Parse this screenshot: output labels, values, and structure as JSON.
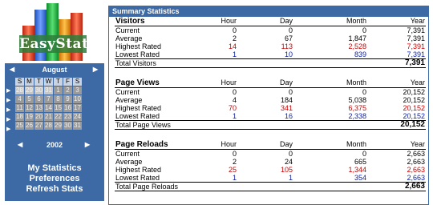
{
  "logo": {
    "text": "EasyStat"
  },
  "calendar": {
    "month": "August",
    "year": "2002",
    "weekdays": [
      "S",
      "M",
      "T",
      "W",
      "T",
      "F",
      "S"
    ],
    "weeks": [
      [
        28,
        29,
        30,
        31,
        1,
        2,
        3
      ],
      [
        4,
        5,
        6,
        7,
        8,
        9,
        10
      ],
      [
        11,
        12,
        13,
        14,
        15,
        16,
        17
      ],
      [
        18,
        19,
        20,
        21,
        22,
        23,
        24
      ],
      [
        25,
        26,
        27,
        28,
        29,
        30,
        31
      ]
    ],
    "prev_month_days": [
      28,
      29,
      30,
      31
    ]
  },
  "nav": {
    "links": [
      "My Statistics",
      "Preferences",
      "Refresh Stats"
    ]
  },
  "summary": {
    "title": "Summary Statistics",
    "columns": [
      "Hour",
      "Day",
      "Month",
      "Year"
    ],
    "sections": [
      {
        "name": "Visitors",
        "rows": [
          {
            "label": "Current",
            "values": [
              "0",
              "0",
              "0",
              "7,391"
            ]
          },
          {
            "label": "Average",
            "values": [
              "2",
              "67",
              "1,847",
              "7,391"
            ]
          },
          {
            "label": "Highest Rated",
            "values": [
              "14",
              "113",
              "2,528",
              "7,391"
            ]
          },
          {
            "label": "Lowest Rated",
            "values": [
              "1",
              "10",
              "839",
              "7,391"
            ]
          }
        ],
        "total_label": "Total Visitors",
        "total_value": "7,391"
      },
      {
        "name": "Page Views",
        "rows": [
          {
            "label": "Current",
            "values": [
              "0",
              "0",
              "0",
              "20,152"
            ]
          },
          {
            "label": "Average",
            "values": [
              "4",
              "184",
              "5,038",
              "20,152"
            ]
          },
          {
            "label": "Highest Rated",
            "values": [
              "70",
              "341",
              "6,375",
              "20,152"
            ]
          },
          {
            "label": "Lowest Rated",
            "values": [
              "1",
              "16",
              "2,338",
              "20,152"
            ]
          }
        ],
        "total_label": "Total Page Views",
        "total_value": "20,152"
      },
      {
        "name": "Page Reloads",
        "rows": [
          {
            "label": "Current",
            "values": [
              "0",
              "0",
              "0",
              "2,663"
            ]
          },
          {
            "label": "Average",
            "values": [
              "2",
              "24",
              "665",
              "2,663"
            ]
          },
          {
            "label": "Highest Rated",
            "values": [
              "25",
              "105",
              "1,344",
              "2,663"
            ]
          },
          {
            "label": "Lowest Rated",
            "values": [
              "1",
              "1",
              "354",
              "2,663"
            ]
          }
        ],
        "total_label": "Total Page Reloads",
        "total_value": "2,663"
      }
    ]
  },
  "colors": {
    "accent": "#3d6aa5",
    "highest": "#cc0000",
    "lowest": "#0a1f9e"
  }
}
